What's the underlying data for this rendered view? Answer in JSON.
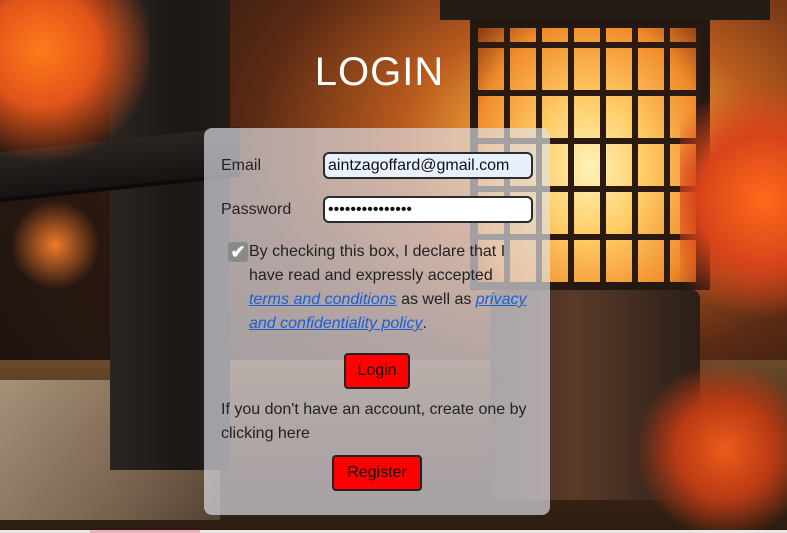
{
  "page": {
    "title": "LOGIN"
  },
  "form": {
    "email_label": "Email",
    "email_value": "aintzagoffard@gmail.com",
    "password_label": "Password",
    "password_value": "•••••••••••••••",
    "consent": {
      "checked": true,
      "check_glyph": "✔",
      "text_before": "By checking this box, I declare that I have read and expressly accepted ",
      "terms_link": "terms and conditions",
      "text_middle": " as well as ",
      "privacy_link": "privacy and confidentiality policy",
      "text_after": "."
    },
    "login_button": "Login",
    "register_prompt": "If you don't have an account, create one by clicking here",
    "register_button": "Register"
  },
  "colors": {
    "button_bg": "#ff0000",
    "link": "#1a5fd6",
    "card_bg": "rgba(224,224,232,0.68)"
  }
}
